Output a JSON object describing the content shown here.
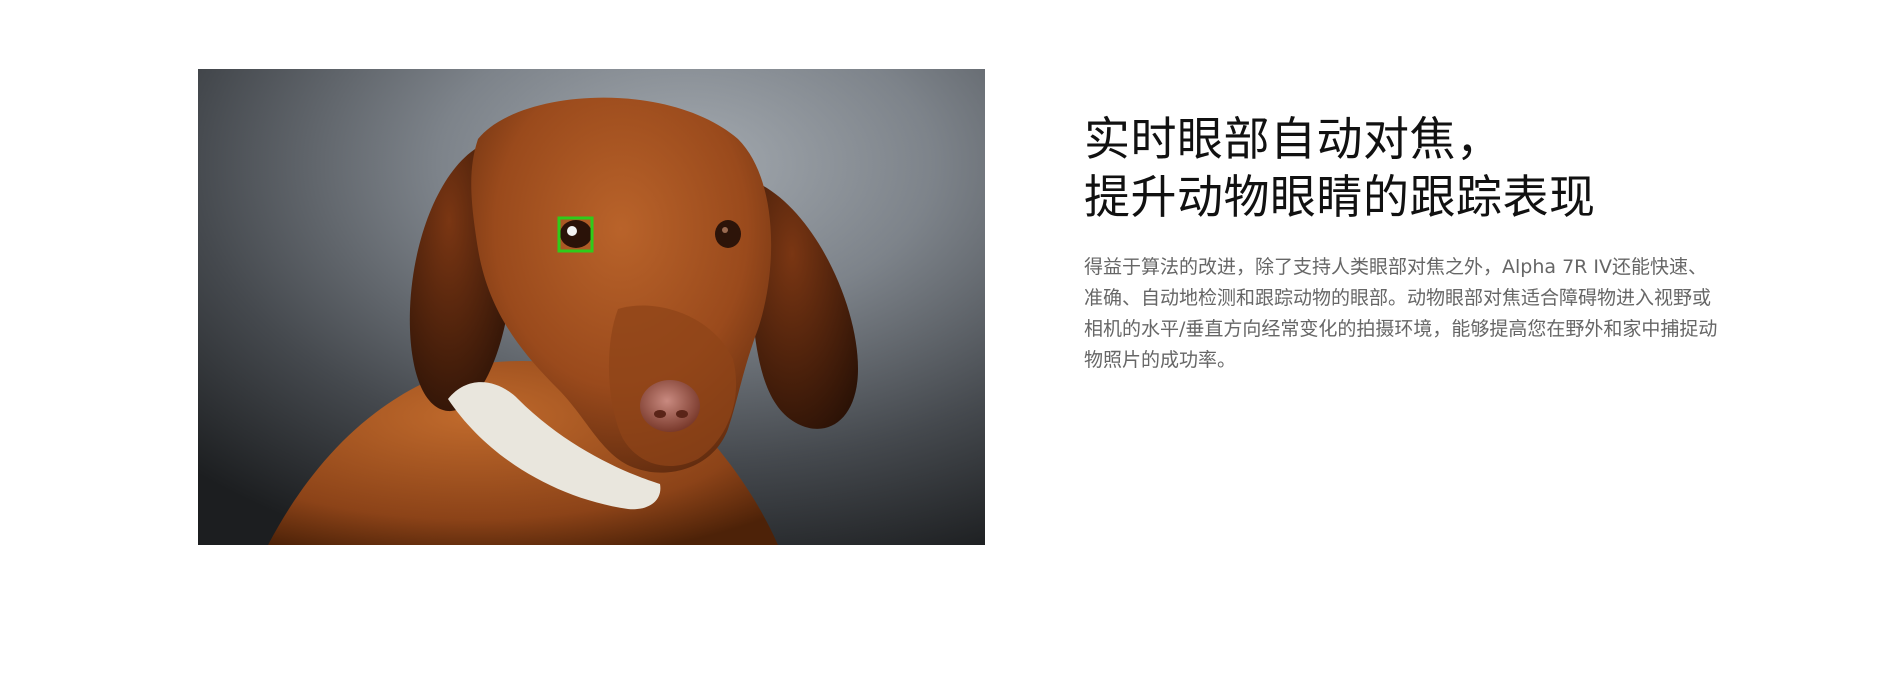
{
  "section": {
    "image_alt": "dog-with-eye-af-tracking-box",
    "headline_line1": "实时眼部自动对焦，",
    "headline_line2": "提升动物眼睛的跟踪表现",
    "description": "得益于算法的改进，除了支持人类眼部对焦之外，Alpha 7R IV还能快速、准确、自动地检测和跟踪动物的眼部。动物眼部对焦适合障碍物进入视野或相机的水平/垂直方向经常变化的拍摄环境，能够提高您在野外和家中捕捉动物照片的成功率。"
  },
  "colors": {
    "page_background": "#ffffff",
    "headline": "#111111",
    "description": "#666666",
    "af_box": "#2ecc1a",
    "dog_fur": "#a8501f"
  }
}
